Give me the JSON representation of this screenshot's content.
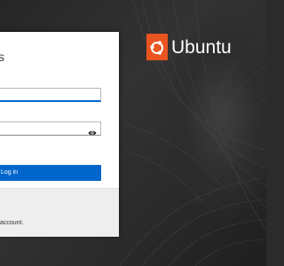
{
  "brand": {
    "name": "Ubuntu",
    "accent": "#e95420",
    "logo_icon": "circle-of-friends-icon"
  },
  "login": {
    "title": "s",
    "username_value": "",
    "password_value": "",
    "show_password_icon": "eye-icon",
    "submit_label": "Log in",
    "primary_color": "#0066cc"
  },
  "footer": {
    "text": "account."
  }
}
